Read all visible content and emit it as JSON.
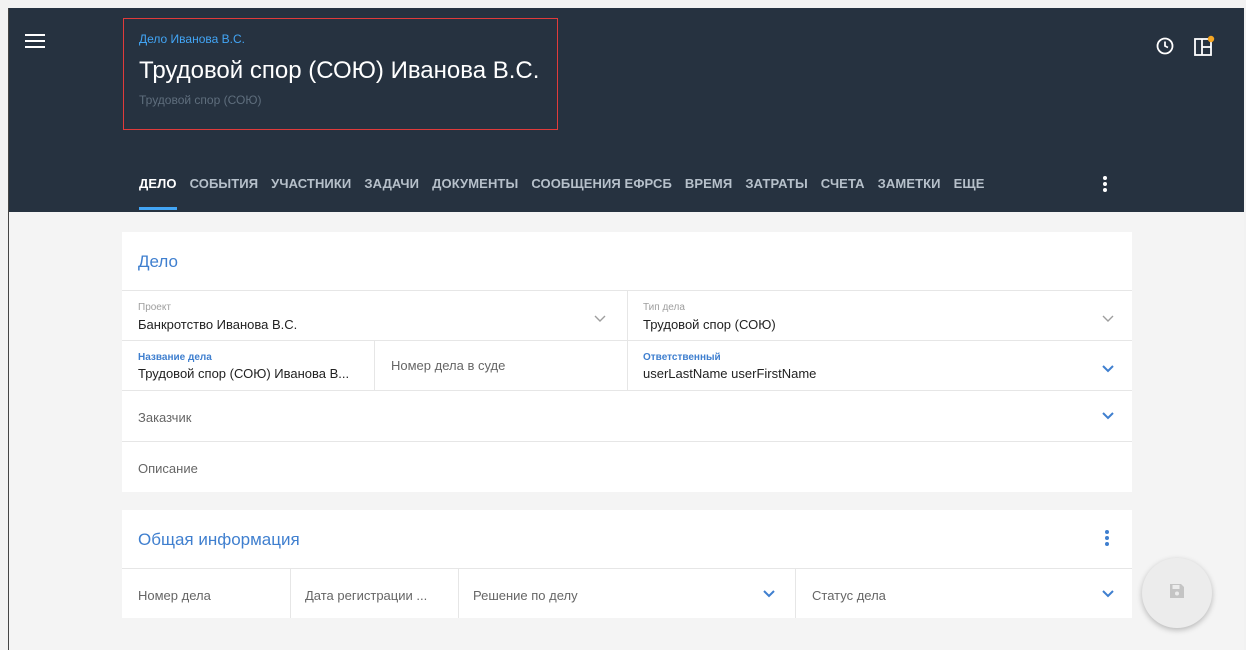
{
  "header": {
    "breadcrumb": "Дело Иванова В.С.",
    "title": "Трудовой спор (СОЮ) Иванова В.С.",
    "subtitle": "Трудовой спор (СОЮ)",
    "icons": [
      "menu-icon",
      "clock-icon",
      "layout-icon"
    ]
  },
  "tabs": [
    "ДЕЛО",
    "СОБЫТИЯ",
    "УЧАСТНИКИ",
    "ЗАДАЧИ",
    "ДОКУМЕНТЫ",
    "СООБЩЕНИЯ ЕФРСБ",
    "ВРЕМЯ",
    "ЗАТРАТЫ",
    "СЧЕТА",
    "ЗАМЕТКИ",
    "ЕЩЕ"
  ],
  "active_tab": "ДЕЛО",
  "case_card": {
    "title": "Дело",
    "project_label": "Проект",
    "project_value": "Банкротство Иванова В.С.",
    "type_label": "Тип дела",
    "type_value": "Трудовой спор (СОЮ)",
    "name_label": "Название дела",
    "name_value": "Трудовой спор (СОЮ) Иванова В...",
    "court_number_placeholder": "Номер дела в суде",
    "responsible_label": "Ответственный",
    "responsible_value": "userLastName userFirstName",
    "customer_placeholder": "Заказчик",
    "description_placeholder": "Описание"
  },
  "general_card": {
    "title": "Общая информация",
    "case_number_placeholder": "Номер дела",
    "registration_date_placeholder": "Дата регистрации ...",
    "decision_placeholder": "Решение по делу",
    "status_placeholder": "Статус дела"
  },
  "colors": {
    "header_bg": "#263240",
    "accent": "#42a5f5",
    "card_title": "#3f7fcf",
    "highlight_border": "#e03b3b"
  },
  "fab_icon": "save-icon"
}
